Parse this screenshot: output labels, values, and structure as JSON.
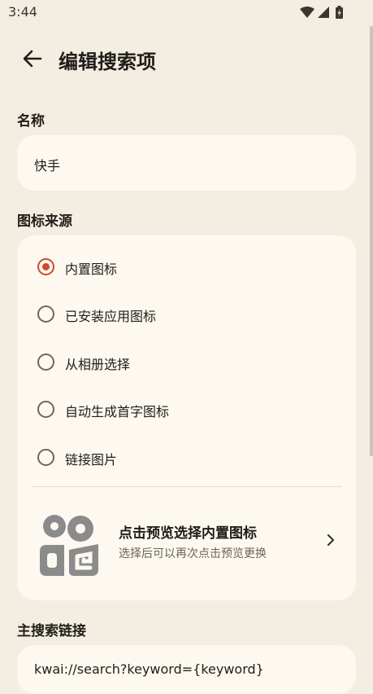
{
  "status_bar": {
    "time": "3:44"
  },
  "app_bar": {
    "title": "编辑搜索项"
  },
  "name_section": {
    "label": "名称",
    "value": "快手"
  },
  "icon_source": {
    "label": "图标来源",
    "options": [
      {
        "label": "内置图标",
        "selected": true
      },
      {
        "label": "已安装应用图标",
        "selected": false
      },
      {
        "label": "从相册选择",
        "selected": false
      },
      {
        "label": "自动生成首字图标",
        "selected": false
      },
      {
        "label": "链接图片",
        "selected": false
      }
    ],
    "preview": {
      "title": "点击预览选择内置图标",
      "subtitle": "选择后可以再次点击预览更换"
    }
  },
  "main_link": {
    "label": "主搜索链接",
    "value": "kwai://search?keyword={keyword}"
  },
  "colors": {
    "accent": "#d04a2c",
    "background": "#f4eee2",
    "card": "#fdf9f0"
  }
}
